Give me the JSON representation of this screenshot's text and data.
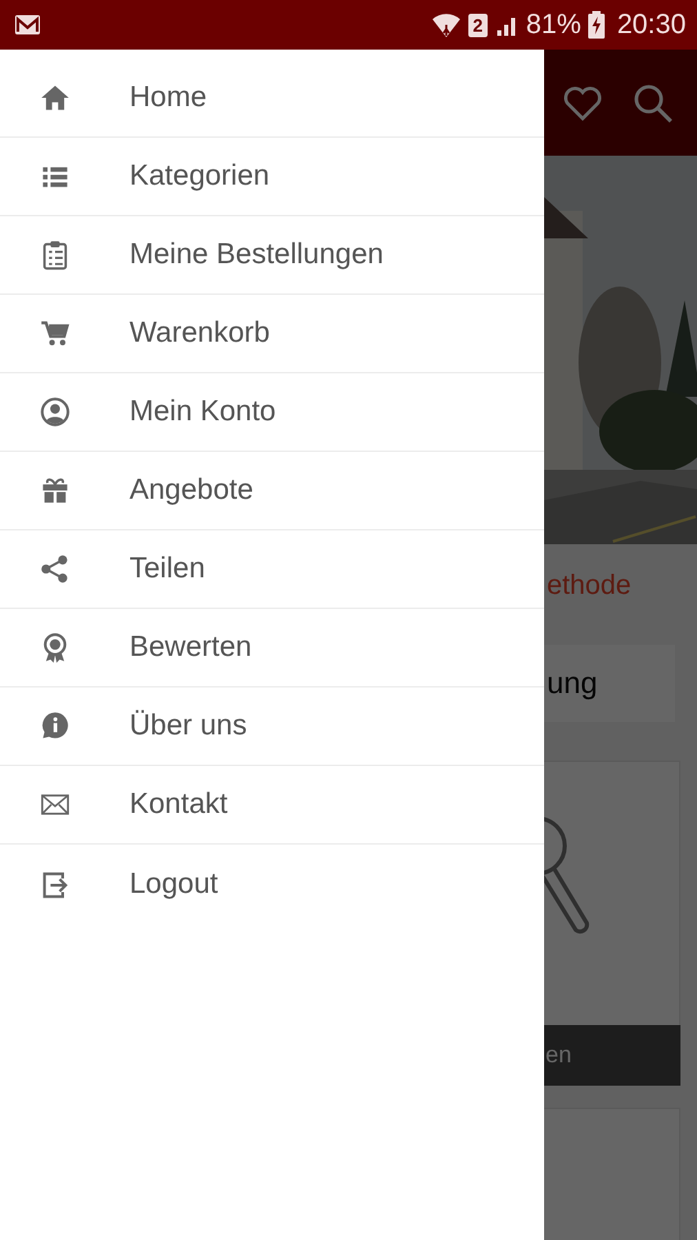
{
  "status_bar": {
    "sim_slot": "2",
    "battery": "81%",
    "time": "20:30"
  },
  "drawer": {
    "items": [
      {
        "label": "Home"
      },
      {
        "label": "Kategorien"
      },
      {
        "label": "Meine Bestellungen"
      },
      {
        "label": "Warenkorb"
      },
      {
        "label": "Mein Konto"
      },
      {
        "label": "Angebote"
      },
      {
        "label": "Teilen"
      },
      {
        "label": "Bewerten"
      },
      {
        "label": "Über uns"
      },
      {
        "label": "Kontakt"
      },
      {
        "label": "Logout"
      }
    ]
  },
  "background": {
    "method_label": "ethode",
    "card_title": "ung",
    "button": "en"
  }
}
